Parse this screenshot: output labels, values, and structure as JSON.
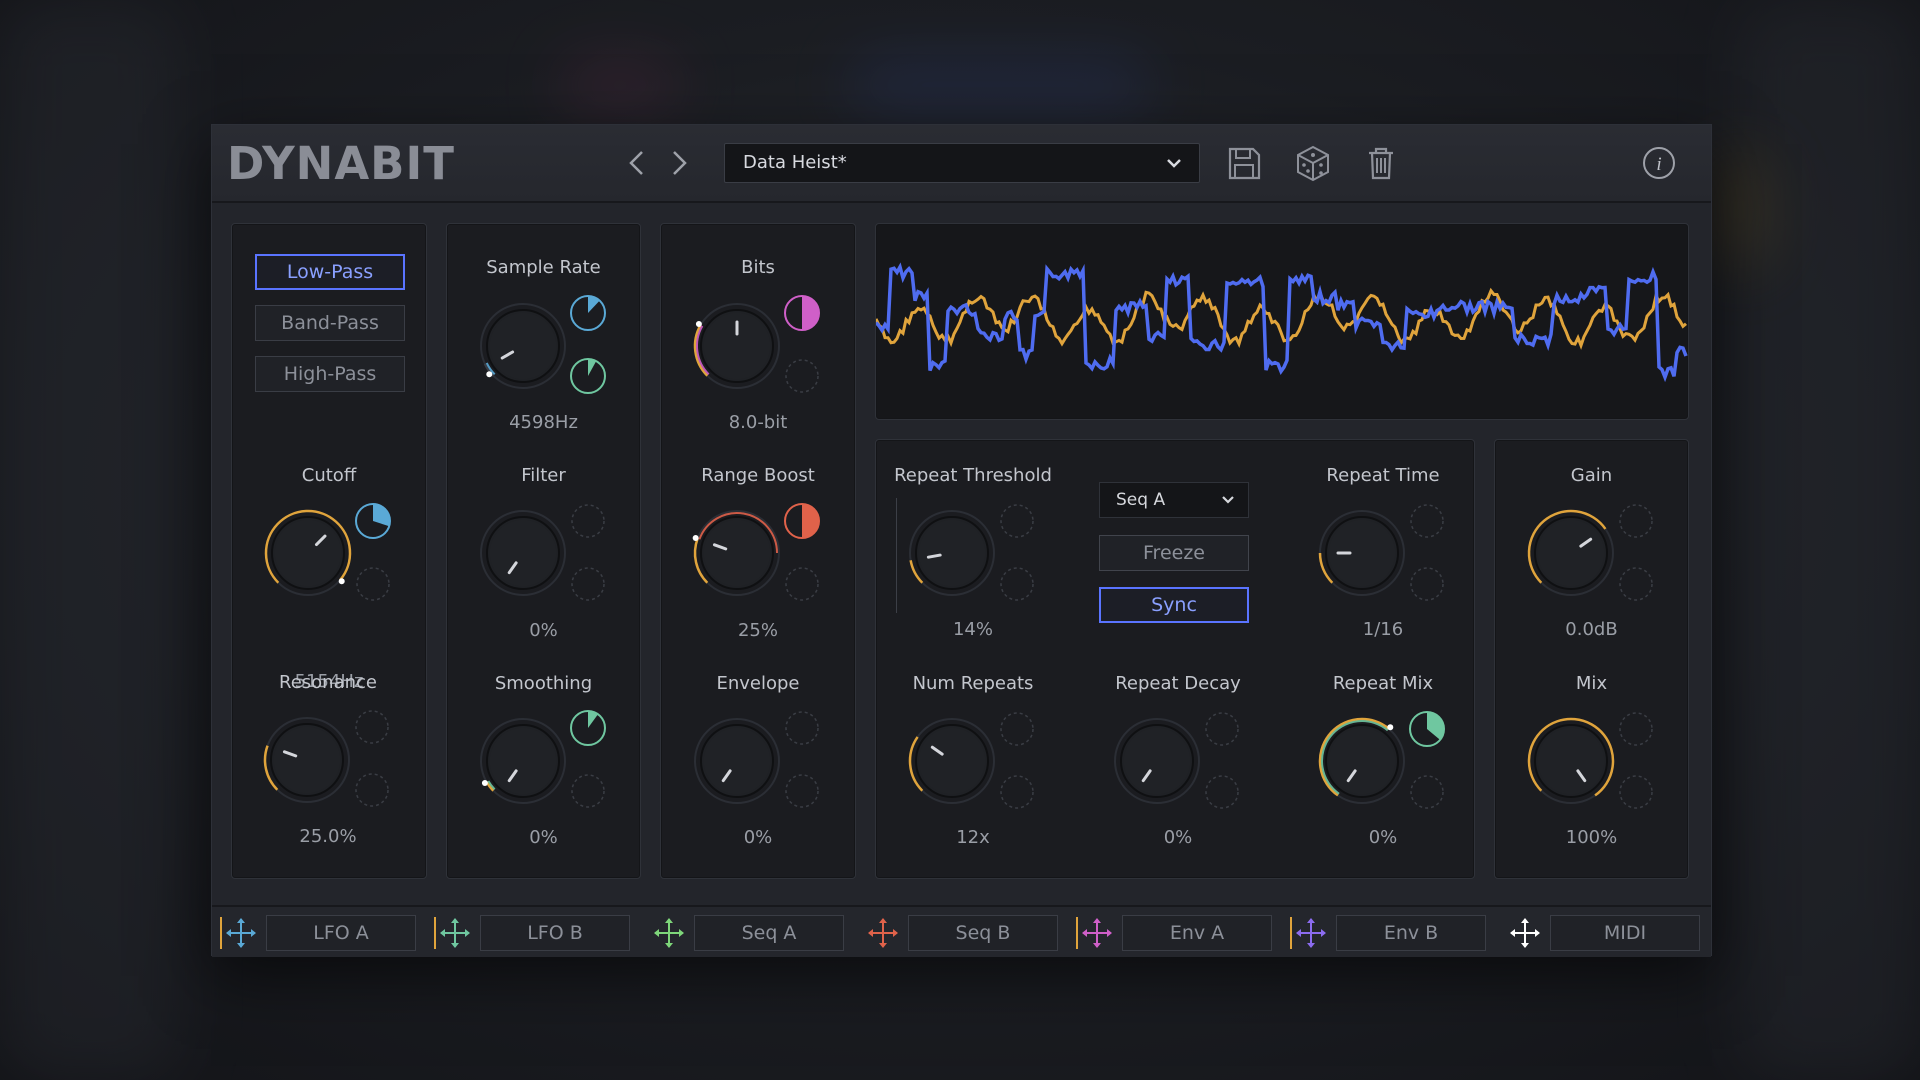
{
  "app": {
    "logo": "DYNABIT"
  },
  "header": {
    "preset": "Data Heist*",
    "icons": [
      "chevron-left-icon",
      "chevron-right-icon",
      "save-icon",
      "dice-icon",
      "trash-icon",
      "info-icon"
    ]
  },
  "filter": {
    "modes": [
      "Low-Pass",
      "Band-Pass",
      "High-Pass"
    ],
    "active_mode": "Low-Pass",
    "cutoff": {
      "label": "Cutoff",
      "value": "5154Hz"
    },
    "resonance": {
      "label": "Resonance",
      "value": "25.0%"
    }
  },
  "samplerate": {
    "sample_rate": {
      "label": "Sample Rate",
      "value": "4598Hz"
    },
    "filter": {
      "label": "Filter",
      "value": "0%"
    },
    "smoothing": {
      "label": "Smoothing",
      "value": "0%"
    }
  },
  "bits": {
    "bits": {
      "label": "Bits",
      "value": "8.0-bit"
    },
    "range_boost": {
      "label": "Range Boost",
      "value": "25%"
    },
    "envelope": {
      "label": "Envelope",
      "value": "0%"
    }
  },
  "repeat": {
    "threshold": {
      "label": "Repeat Threshold",
      "value": "14%"
    },
    "source": "Seq A",
    "freeze_label": "Freeze",
    "sync_label": "Sync",
    "time": {
      "label": "Repeat Time",
      "value": "1/16"
    },
    "num": {
      "label": "Num Repeats",
      "value": "12x"
    },
    "decay": {
      "label": "Repeat Decay",
      "value": "0%"
    },
    "mix": {
      "label": "Repeat Mix",
      "value": "0%"
    }
  },
  "output": {
    "gain": {
      "label": "Gain",
      "value": "0.0dB"
    },
    "mix": {
      "label": "Mix",
      "value": "100%"
    }
  },
  "modulators": [
    {
      "label": "LFO A",
      "color": "#5aa9d6"
    },
    {
      "label": "LFO B",
      "color": "#6fc7a0"
    },
    {
      "label": "Seq A",
      "color": "#7ed67a"
    },
    {
      "label": "Seq B",
      "color": "#e0624a"
    },
    {
      "label": "Env A",
      "color": "#cf5fc8"
    },
    {
      "label": "Env B",
      "color": "#8c6cf0"
    },
    {
      "label": "MIDI",
      "color": "#ffffff"
    }
  ],
  "colors": {
    "accent_blue": "#5a74ff",
    "knob_ring": "#e0a43c",
    "wave_blue": "#4f6cf0",
    "wave_orange": "#e0a43c"
  }
}
